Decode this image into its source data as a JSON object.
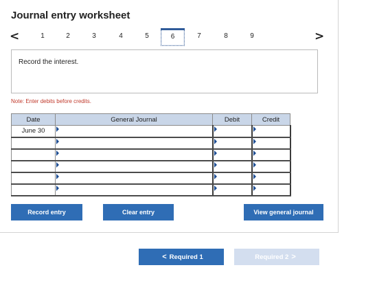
{
  "title": "Journal entry worksheet",
  "pager": {
    "prev_icon": "chevron-left-icon",
    "next_icon": "chevron-right-icon",
    "prev_glyph": "<",
    "next_glyph": ">",
    "pages": [
      "1",
      "2",
      "3",
      "4",
      "5",
      "6",
      "7",
      "8",
      "9"
    ],
    "active_page": "6"
  },
  "instruction": "Record the interest.",
  "note": "Note: Enter debits before credits.",
  "journal": {
    "headers": {
      "date": "Date",
      "general_journal": "General Journal",
      "debit": "Debit",
      "credit": "Credit"
    },
    "rows": [
      {
        "date": "June 30",
        "account": "",
        "debit": "",
        "credit": ""
      },
      {
        "date": "",
        "account": "",
        "debit": "",
        "credit": ""
      },
      {
        "date": "",
        "account": "",
        "debit": "",
        "credit": ""
      },
      {
        "date": "",
        "account": "",
        "debit": "",
        "credit": ""
      },
      {
        "date": "",
        "account": "",
        "debit": "",
        "credit": ""
      },
      {
        "date": "",
        "account": "",
        "debit": "",
        "credit": ""
      }
    ]
  },
  "buttons": {
    "record_entry": "Record entry",
    "clear_entry": "Clear entry",
    "view_general_journal": "View general journal"
  },
  "navigation": {
    "prev_label": "Required 1",
    "next_label": "Required 2",
    "prev_glyph": "<",
    "next_glyph": ">",
    "prev_color": "#2f6db5",
    "next_color": "#d3deef"
  },
  "colors": {
    "accent": "#2f6db5",
    "header_bg": "#c9d6e8",
    "note": "#c0392b"
  }
}
